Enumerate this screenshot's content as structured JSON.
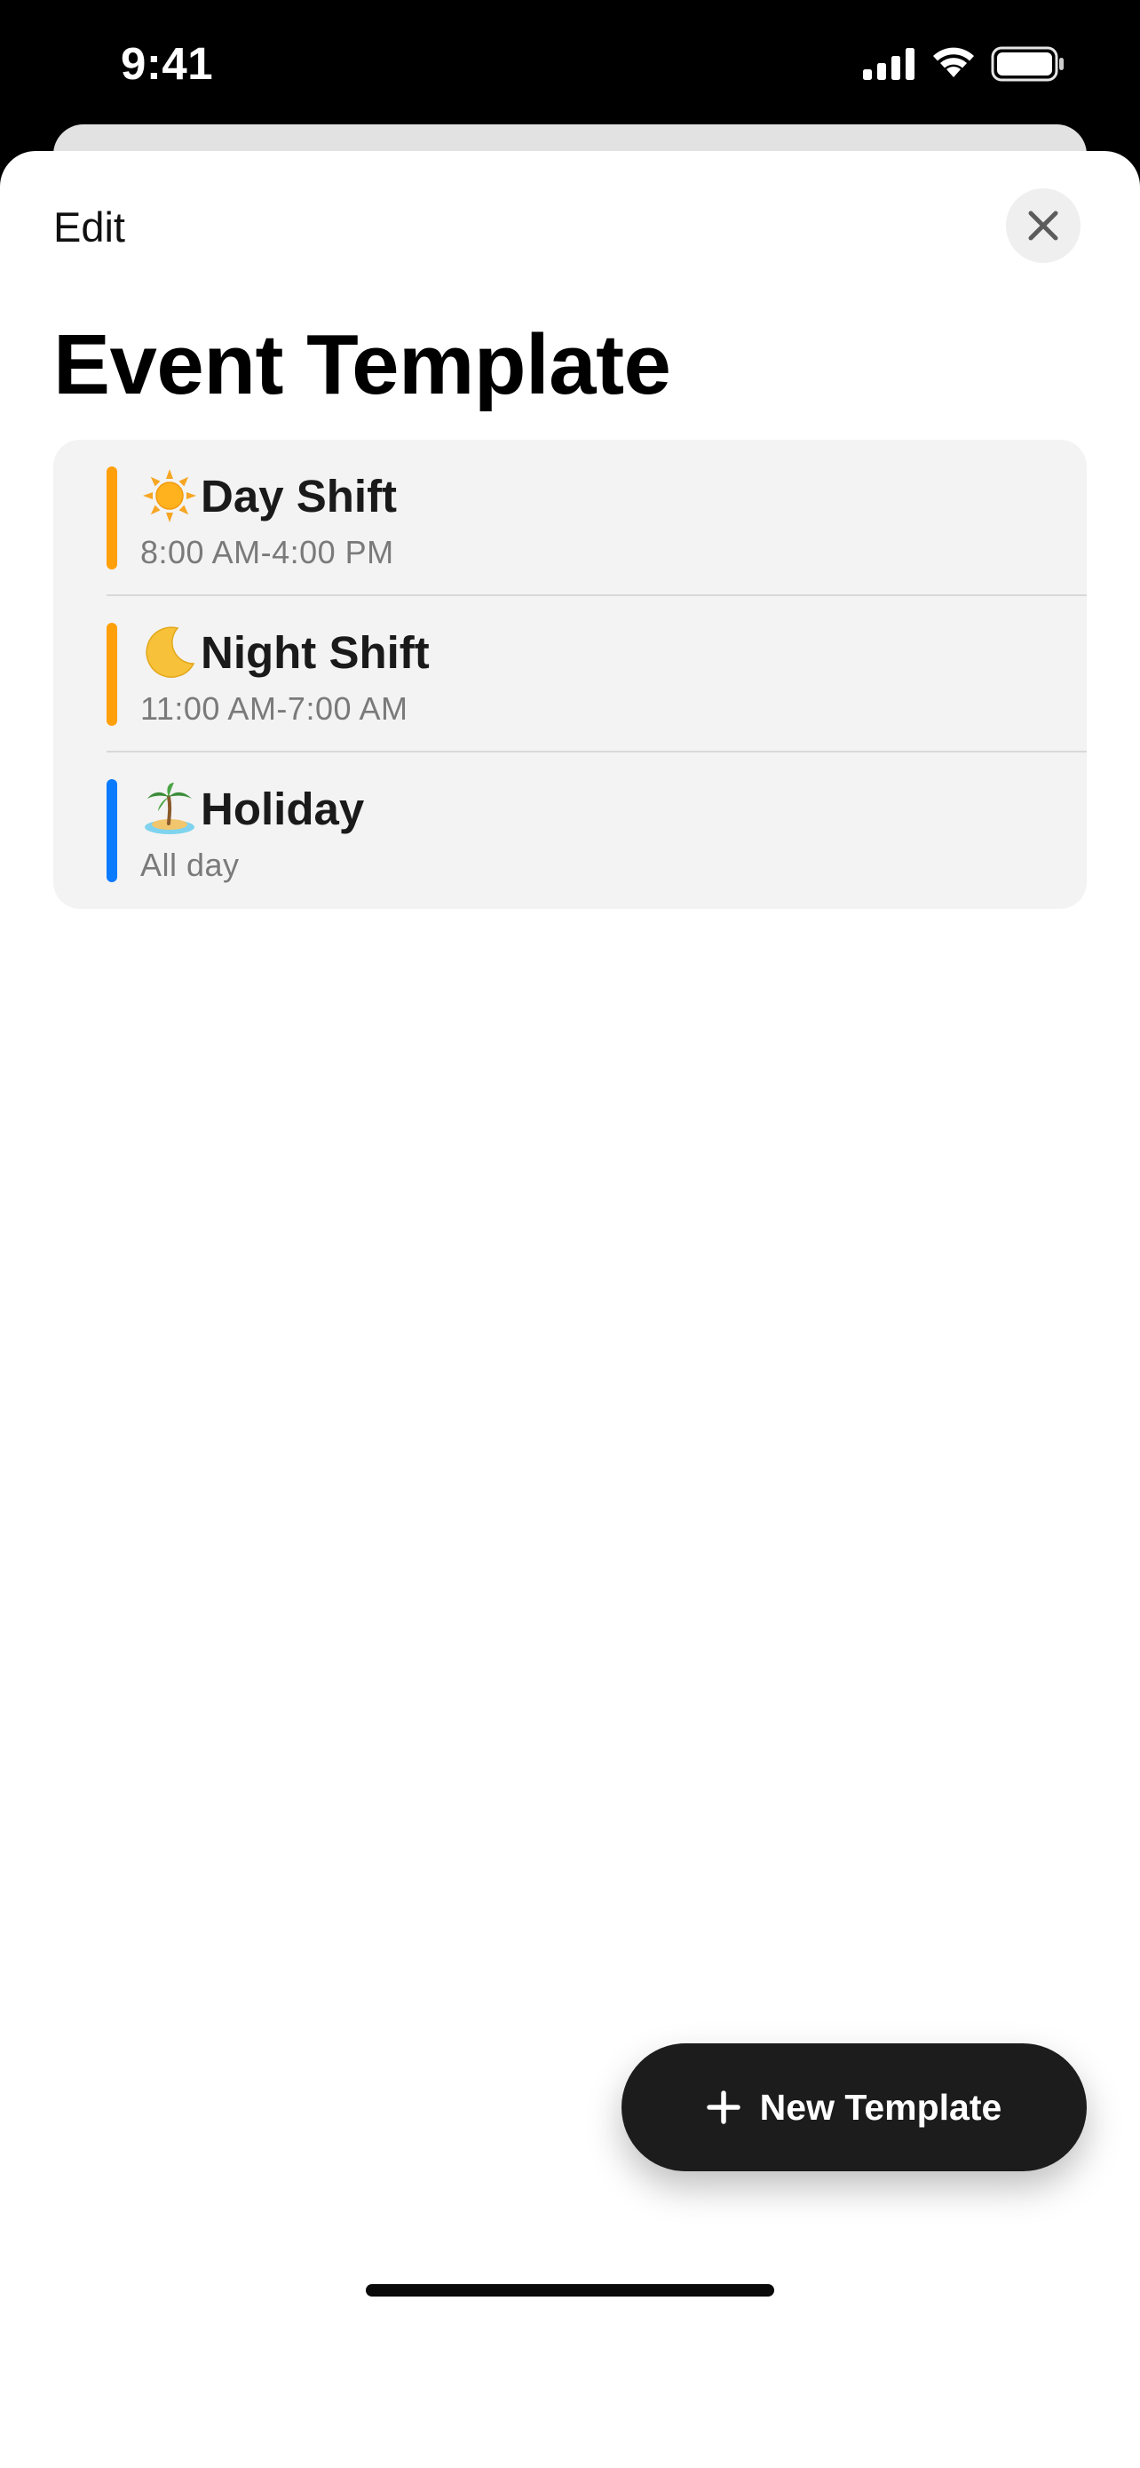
{
  "status_bar": {
    "time": "9:41",
    "icons": [
      "signal-icon",
      "wifi-icon",
      "battery-icon"
    ]
  },
  "header": {
    "edit_label": "Edit",
    "close_icon": "close-icon",
    "title": "Event Template"
  },
  "templates": [
    {
      "emoji": "sun-icon",
      "title": "Day Shift",
      "subtitle": "8:00 AM-4:00 PM",
      "color": "#FF9F0A"
    },
    {
      "emoji": "moon-icon",
      "title": "Night Shift",
      "subtitle": "11:00 AM-7:00 AM",
      "color": "#FF9F0A"
    },
    {
      "emoji": "palm-island-icon",
      "title": "Holiday",
      "subtitle": "All day",
      "color": "#0A7AFF"
    }
  ],
  "fab": {
    "icon": "plus-icon",
    "label": "New Template"
  },
  "colors": {
    "sheet_background": "#FFFFFF",
    "list_background": "#F3F3F3",
    "button_background": "#1C1C1C",
    "subtitle_text": "#7A7A7A"
  }
}
